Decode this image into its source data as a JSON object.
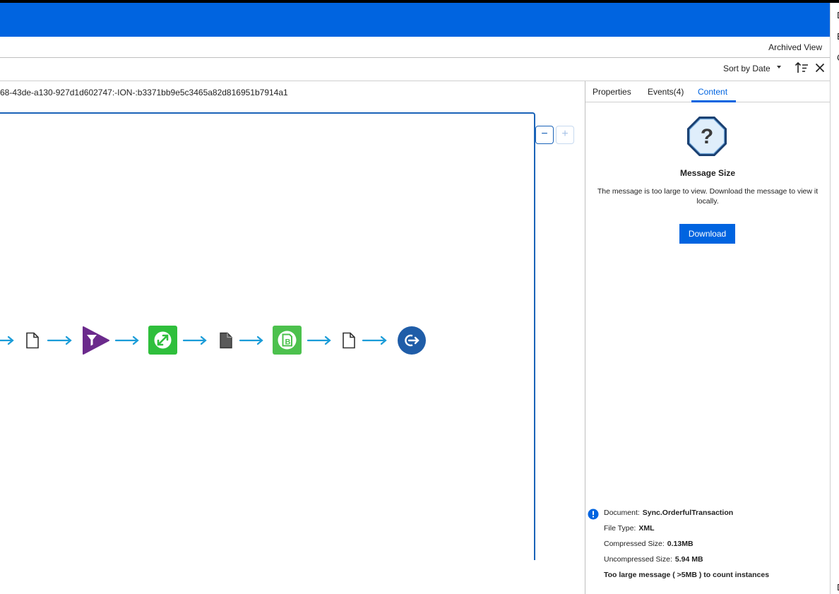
{
  "top_bar": {
    "accent": "#0064e0"
  },
  "toolbar": {
    "archived_view": "Archived View",
    "sort_label": "Sort by Date"
  },
  "message_id": "68-43de-a130-927d1d602747:-ION-:b3371bb9e5c3465a82d816951b7914a1",
  "right_strip_letters": [
    "D",
    "E",
    "C",
    "D"
  ],
  "zoom": {
    "minus": "−",
    "plus": "+"
  },
  "flow_nodes": [
    {
      "kind": "document",
      "icon": "document-icon"
    },
    {
      "kind": "filter",
      "icon": "filter-icon",
      "color": "#6b2a8c"
    },
    {
      "kind": "mapping",
      "icon": "mapping-icon",
      "color": "#2fbf3c"
    },
    {
      "kind": "document-filled",
      "icon": "document-filled-icon"
    },
    {
      "kind": "bod",
      "icon": "bod-icon",
      "color": "#4cc14d"
    },
    {
      "kind": "document",
      "icon": "document-icon"
    },
    {
      "kind": "exit",
      "icon": "exit-icon",
      "color": "#1f5da8"
    }
  ],
  "panel": {
    "tabs": [
      {
        "label": "Properties"
      },
      {
        "label": "Events(4)"
      },
      {
        "label": "Content",
        "active": true
      }
    ],
    "message_title": "Message Size",
    "message_text": "The message is too large to view. Download the message to view it locally.",
    "download_label": "Download",
    "info": {
      "document_label": "Document:",
      "document_value": "Sync.OrderfulTransaction",
      "file_type_label": "File Type:",
      "file_type_value": "XML",
      "compressed_label": "Compressed Size:",
      "compressed_value": "0.13MB",
      "uncompressed_label": "Uncompressed Size:",
      "uncompressed_value": "5.94 MB",
      "warning": "Too large message ( >5MB ) to count instances"
    }
  }
}
